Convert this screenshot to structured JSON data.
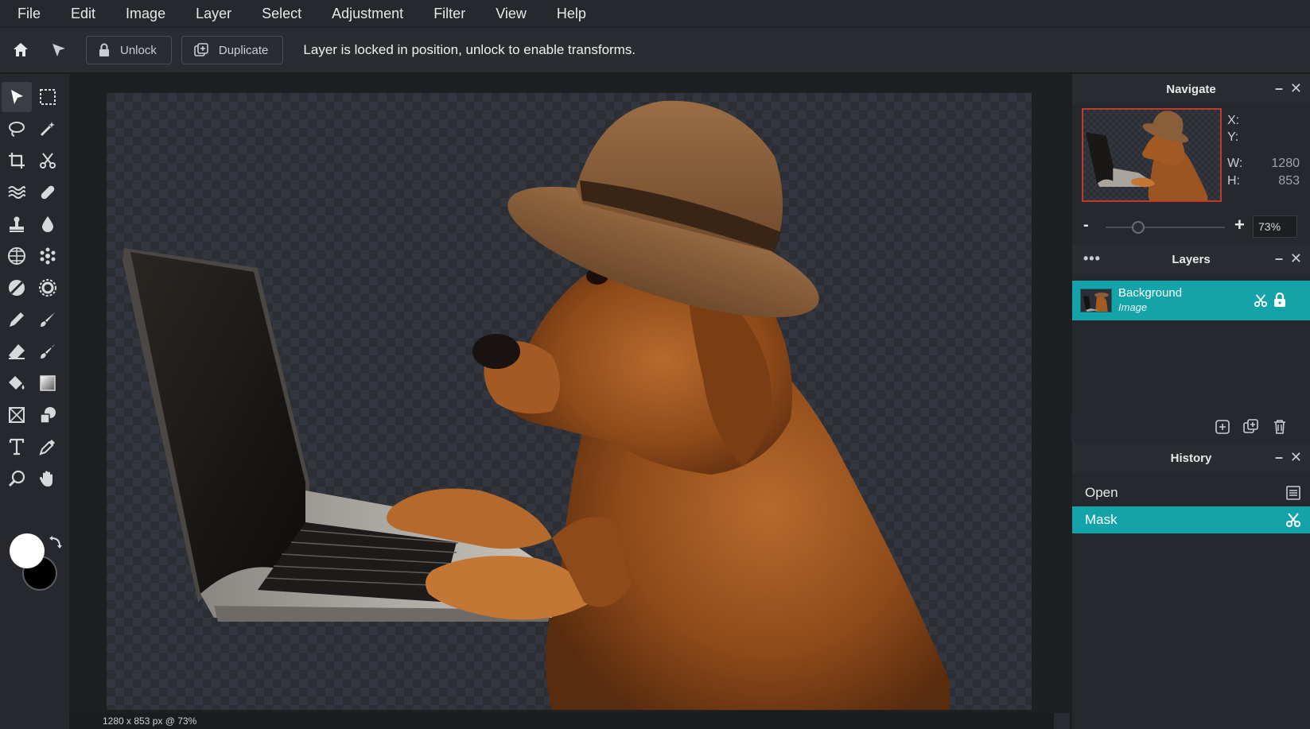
{
  "menu": [
    "File",
    "Edit",
    "Image",
    "Layer",
    "Select",
    "Adjustment",
    "Filter",
    "View",
    "Help"
  ],
  "options": {
    "unlock_label": "Unlock",
    "duplicate_label": "Duplicate",
    "message": "Layer is locked in position, unlock to enable transforms."
  },
  "status": {
    "text": "1280 x 853 px @ 73%"
  },
  "navigate": {
    "title": "Navigate",
    "x_label": "X:",
    "y_label": "Y:",
    "w_label": "W:",
    "h_label": "H:",
    "w_value": "1280",
    "h_value": "853",
    "zoom_value": "73%",
    "zoom_min_label": "-",
    "zoom_plus_label": "+",
    "zoom_fraction": 0.27
  },
  "layers": {
    "title": "Layers",
    "items": [
      {
        "name": "Background",
        "type": "Image"
      }
    ]
  },
  "history": {
    "title": "History",
    "items": [
      {
        "label": "Open"
      },
      {
        "label": "Mask"
      }
    ]
  },
  "colors": {
    "accent": "#14a3a8",
    "foreground": "#ffffff",
    "background": "#000000"
  }
}
